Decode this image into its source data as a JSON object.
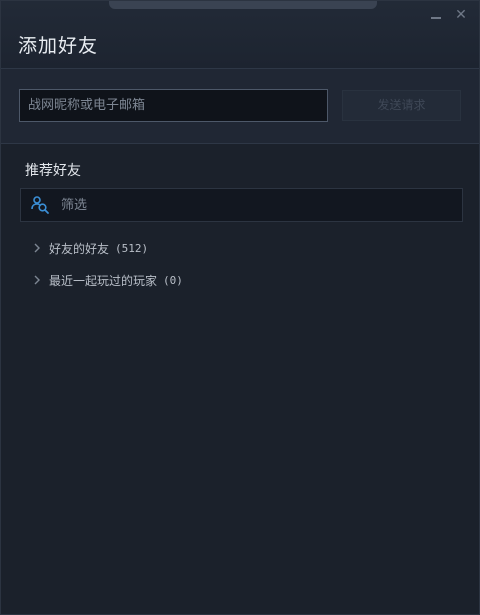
{
  "window": {
    "title": "添加好友",
    "minimize_icon": "minimize-icon",
    "close_icon": "close-icon",
    "close_glyph": "✕"
  },
  "add_friend": {
    "input_value": "",
    "input_placeholder": "战网昵称或电子邮箱",
    "send_label": "发送请求"
  },
  "recommended": {
    "title": "推荐好友",
    "filter_placeholder": "筛选",
    "filter_value": "",
    "groups": [
      {
        "label": "好友的好友",
        "count": "(512)"
      },
      {
        "label": "最近一起玩过的玩家",
        "count": "(0)"
      }
    ]
  },
  "colors": {
    "background": "#1b212b",
    "accent": "#3b8fd6",
    "text": "#c8cdd4"
  }
}
